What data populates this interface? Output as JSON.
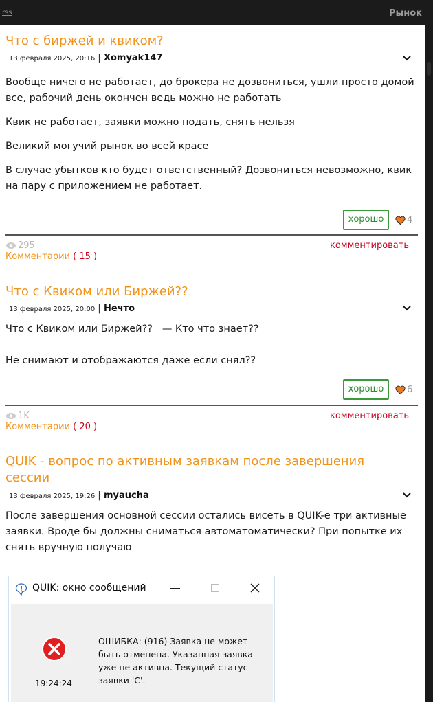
{
  "header": {
    "rss": "rss",
    "section": "Рынок"
  },
  "posts": [
    {
      "title": "Что с биржей и квиком?",
      "date": "13 февраля 2025, 20:16",
      "author": "Xomyak147",
      "paragraphs": [
        "Вообще ничего не работает, до брокера не дозвониться, ушли просто домой все, рабочий день окончен ведь можно не работать",
        "Квик не работает, заявки можно подать, снять нельзя",
        "Великий могучий рынок во всей красе",
        "В случае убытков кто будет ответственный? Дозвониться невозможно, квик на пару с приложением не работает."
      ],
      "good_label": "хорошо",
      "likes": "4",
      "views": "295",
      "comment_label": "комментировать",
      "comments_label": "Комментарии",
      "comments_count": "( 15 )"
    },
    {
      "title": "Что с Квиком или Биржей??",
      "date": "13 февраля 2025, 20:00",
      "author": "Нечто",
      "paragraphs": [
        "Что с Квиком или Биржей??   — Кто что знает??",
        "Не снимают и отображаются даже если снял??"
      ],
      "good_label": "хорошо",
      "likes": "6",
      "views": "1K",
      "comment_label": "комментировать",
      "comments_label": "Комментарии",
      "comments_count": "( 20 )"
    },
    {
      "title": "QUIK - вопрос по активным заявкам после завершения сессии",
      "date": "13 февраля 2025, 19:26",
      "author": "myaucha",
      "paragraphs": [
        "После завершения основной сессии остались висеть в QUIK-е три активные заявки. Вроде бы должны сниматься автоматоматически? При попытке их снять вручную получаю"
      ]
    }
  ],
  "quik_dialog": {
    "title": "QUIK: окно сообщений",
    "message": "ОШИБКА: (916) Заявка не может быть отменена. Указанная заявка уже не активна. Текущий статус заявки 'C'.",
    "time": "19:24:24"
  },
  "colors": {
    "title": "#f0941b",
    "comment_link": "#c8001e",
    "good_border": "#3a9a3a",
    "heart": "#f07a1e"
  }
}
